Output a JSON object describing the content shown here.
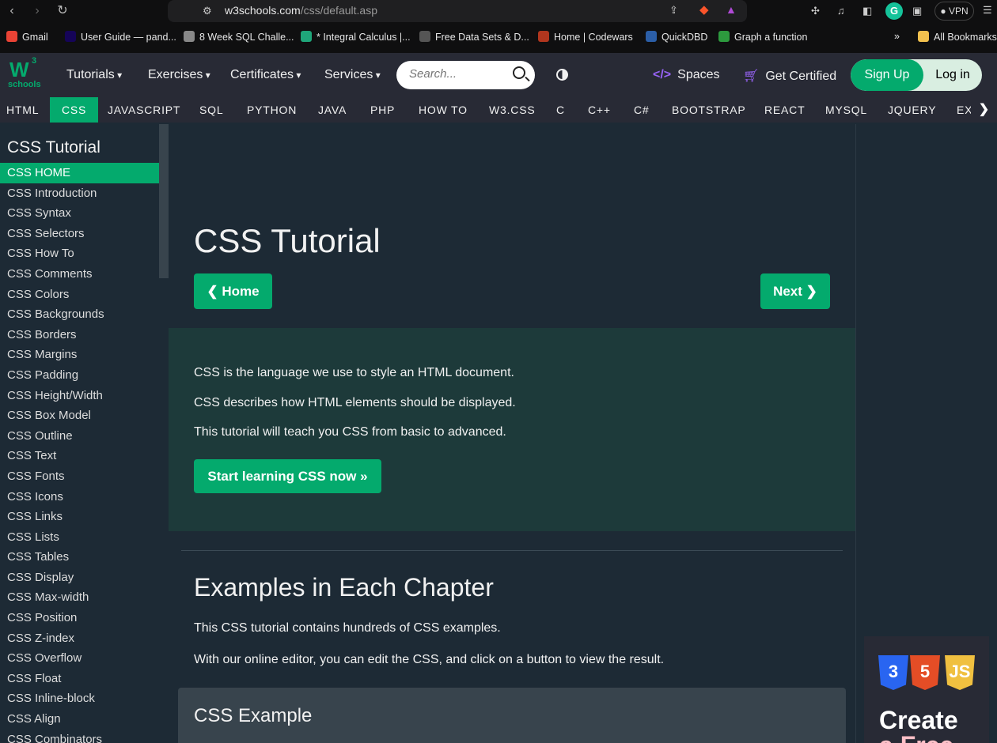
{
  "browser": {
    "url_host": "w3schools.com",
    "url_path": "/css/default.asp",
    "vpn_label": "VPN",
    "bookmarks": [
      {
        "label": "Gmail",
        "color": "#ea4335"
      },
      {
        "label": "User Guide — pand...",
        "color": "#150458"
      },
      {
        "label": "8 Week SQL Challe...",
        "color": "#888888"
      },
      {
        "label": "* Integral Calculus |...",
        "color": "#1fa67a"
      },
      {
        "label": "Free Data Sets & D...",
        "color": "#555555"
      },
      {
        "label": "Home | Codewars",
        "color": "#b1361e"
      },
      {
        "label": "QuickDBD",
        "color": "#2b5ea7"
      },
      {
        "label": "Graph a function",
        "color": "#2d9a3e"
      }
    ],
    "more_bookmarks": "»",
    "all_bookmarks": "All Bookmarks"
  },
  "header": {
    "logo_w3": "W",
    "logo_sup": "3",
    "logo_schools": "schools",
    "menus": [
      "Tutorials",
      "Exercises",
      "Certificates",
      "Services"
    ],
    "search_placeholder": "Search...",
    "spaces": "Spaces",
    "get_certified": "Get Certified",
    "sign_up": "Sign Up",
    "log_in": "Log in"
  },
  "subjects": [
    "HTML",
    "CSS",
    "JAVASCRIPT",
    "SQL",
    "PYTHON",
    "JAVA",
    "PHP",
    "HOW TO",
    "W3.CSS",
    "C",
    "C++",
    "C#",
    "BOOTSTRAP",
    "REACT",
    "MYSQL",
    "JQUERY",
    "EX"
  ],
  "active_subject": "CSS",
  "sidebar": {
    "title": "CSS Tutorial",
    "items": [
      "CSS HOME",
      "CSS Introduction",
      "CSS Syntax",
      "CSS Selectors",
      "CSS How To",
      "CSS Comments",
      "CSS Colors",
      "CSS Backgrounds",
      "CSS Borders",
      "CSS Margins",
      "CSS Padding",
      "CSS Height/Width",
      "CSS Box Model",
      "CSS Outline",
      "CSS Text",
      "CSS Fonts",
      "CSS Icons",
      "CSS Links",
      "CSS Lists",
      "CSS Tables",
      "CSS Display",
      "CSS Max-width",
      "CSS Position",
      "CSS Z-index",
      "CSS Overflow",
      "CSS Float",
      "CSS Inline-block",
      "CSS Align",
      "CSS Combinators"
    ],
    "active_item": "CSS HOME"
  },
  "main": {
    "title": "CSS Tutorial",
    "home_button": "❮ Home",
    "next_button": "Next ❯",
    "intro_lines": [
      "CSS is the language we use to style an HTML document.",
      "CSS describes how HTML elements should be displayed.",
      "This tutorial will teach you CSS from basic to advanced."
    ],
    "start_button": "Start learning CSS now »",
    "examples_heading": "Examples in Each Chapter",
    "examples_para1": "This CSS tutorial contains hundreds of CSS examples.",
    "examples_para2": "With our online editor, you can edit the CSS, and click on a button to view the result.",
    "example_box_title": "CSS Example"
  },
  "ad": {
    "badges": [
      {
        "label": "3",
        "color": "#2965f1"
      },
      {
        "label": "5",
        "color": "#e44d26"
      },
      {
        "label": "JS",
        "color": "#f0c040"
      }
    ],
    "line1": "Create",
    "line2": "a Free"
  },
  "colors": {
    "accent": "#04aa6d",
    "nav_bg": "#282a35",
    "page_bg": "#1d2a35",
    "intro_bg": "#1d3a3a"
  }
}
